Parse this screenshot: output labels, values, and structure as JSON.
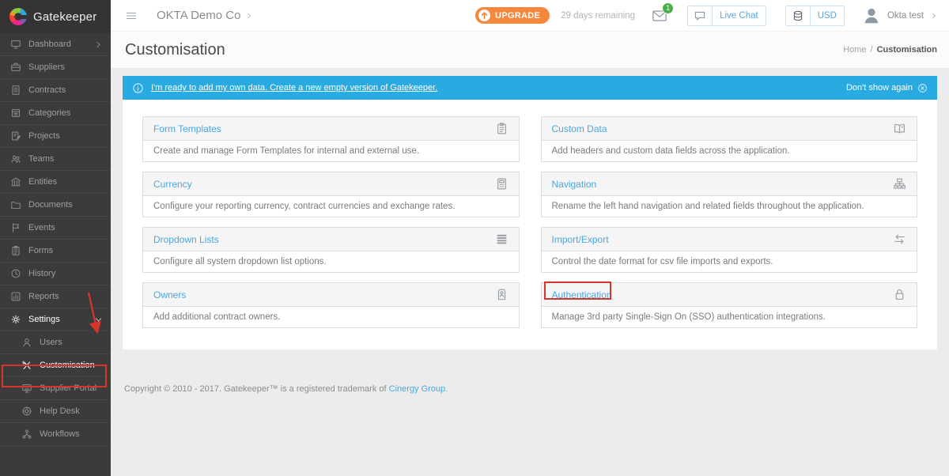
{
  "colors": {
    "accent_blue": "#29abe2",
    "link_blue": "#4ba6dd",
    "upgrade_orange": "#f6883d",
    "badge_green": "#47b04b",
    "annotation_red": "#d7342c",
    "sidebar_bg": "#3b3b3b"
  },
  "sidebar": {
    "logo_text": "Gatekeeper",
    "items": [
      {
        "label": "Dashboard",
        "icon": "monitor-icon",
        "chevron": "right"
      },
      {
        "label": "Suppliers",
        "icon": "briefcase-icon"
      },
      {
        "label": "Contracts",
        "icon": "contract-icon"
      },
      {
        "label": "Categories",
        "icon": "categories-icon"
      },
      {
        "label": "Projects",
        "icon": "project-icon"
      },
      {
        "label": "Teams",
        "icon": "teams-icon"
      },
      {
        "label": "Entities",
        "icon": "bank-icon"
      },
      {
        "label": "Documents",
        "icon": "folder-icon"
      },
      {
        "label": "Events",
        "icon": "flag-icon"
      },
      {
        "label": "Forms",
        "icon": "clipboard-icon"
      },
      {
        "label": "History",
        "icon": "clock-icon"
      },
      {
        "label": "Reports",
        "icon": "chart-icon"
      },
      {
        "label": "Settings",
        "icon": "gear-icon",
        "chevron": "down",
        "active": true
      },
      {
        "label": "Users",
        "icon": "user-icon",
        "sub": true
      },
      {
        "label": "Customisation",
        "icon": "tools-icon",
        "sub": true,
        "active": true
      },
      {
        "label": "Supplier Portal",
        "icon": "portal-icon",
        "sub": true
      },
      {
        "label": "Help Desk",
        "icon": "helpdesk-icon",
        "sub": true
      },
      {
        "label": "Workflows",
        "icon": "workflow-icon",
        "sub": true
      }
    ]
  },
  "topbar": {
    "company": "OKTA Demo Co",
    "upgrade_label": "UPGRADE",
    "trial_text": "29 days remaining",
    "notification_count": "1",
    "live_chat_label": "Live Chat",
    "currency_label": "USD",
    "user_name": "Okta test"
  },
  "page": {
    "title": "Customisation",
    "breadcrumb_home": "Home",
    "breadcrumb_sep": "/",
    "breadcrumb_current": "Customisation"
  },
  "banner": {
    "link_text": "I'm ready to add my own data. Create a new empty version of Gatekeeper.",
    "dismiss_text": "Don't show again"
  },
  "cards": [
    {
      "title": "Form Templates",
      "icon": "clipboard-icon",
      "description": "Create and manage Form Templates for internal and external use."
    },
    {
      "title": "Custom Data",
      "icon": "book-icon",
      "description": "Add headers and custom data fields across the application."
    },
    {
      "title": "Currency",
      "icon": "calculator-icon",
      "description": "Configure your reporting currency, contract currencies and exchange rates."
    },
    {
      "title": "Navigation",
      "icon": "sitemap-icon",
      "description": "Rename the left hand navigation and related fields throughout the application."
    },
    {
      "title": "Dropdown Lists",
      "icon": "list-icon",
      "description": "Configure all system dropdown list options."
    },
    {
      "title": "Import/Export",
      "icon": "import-export-icon",
      "description": "Control the date format for csv file imports and exports."
    },
    {
      "title": "Owners",
      "icon": "owner-badge-icon",
      "description": "Add additional contract owners."
    },
    {
      "title": "Authentication",
      "icon": "lock-icon",
      "description": "Manage 3rd party Single-Sign On (SSO) authentication integrations.",
      "highlighted": true
    }
  ],
  "footer": {
    "text": "Copyright © 2010 - 2017. Gatekeeper™ is a registered trademark of",
    "link_text": "Cinergy Group."
  }
}
